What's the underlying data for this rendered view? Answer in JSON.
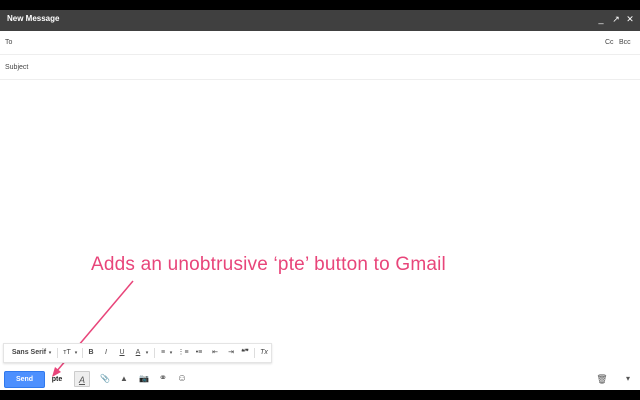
{
  "window": {
    "title": "New Message",
    "controls": {
      "minimize": "_",
      "popout": "↗",
      "close": "✕"
    }
  },
  "fields": {
    "to_label": "To",
    "cc_label": "Cc",
    "bcc_label": "Bcc",
    "subject_placeholder": "Subject"
  },
  "annotation": {
    "text": "Adds an unobtrusive ‘pte’ button to Gmail",
    "color": "#e8457a"
  },
  "format_bar": {
    "font_label": "Sans Serif",
    "items": {
      "size": "ᴛT",
      "bold": "B",
      "italic": "I",
      "underline": "U",
      "text_color": "A",
      "align": "≡",
      "numbered_list": "⋮≡",
      "bulleted_list": "•≡",
      "indent_less": "⇤",
      "indent_more": "⇥",
      "quote": "❝❞",
      "remove_format": "Tx"
    }
  },
  "toolbar": {
    "send_label": "Send",
    "pte_label": "pte",
    "send_color": "#4d90fe",
    "icons": {
      "formatting": "A",
      "attach": "📎",
      "drive": "▲",
      "photo": "📷",
      "link": "⚭",
      "emoji": "☺",
      "trash": "🗑",
      "more": "▾"
    }
  }
}
